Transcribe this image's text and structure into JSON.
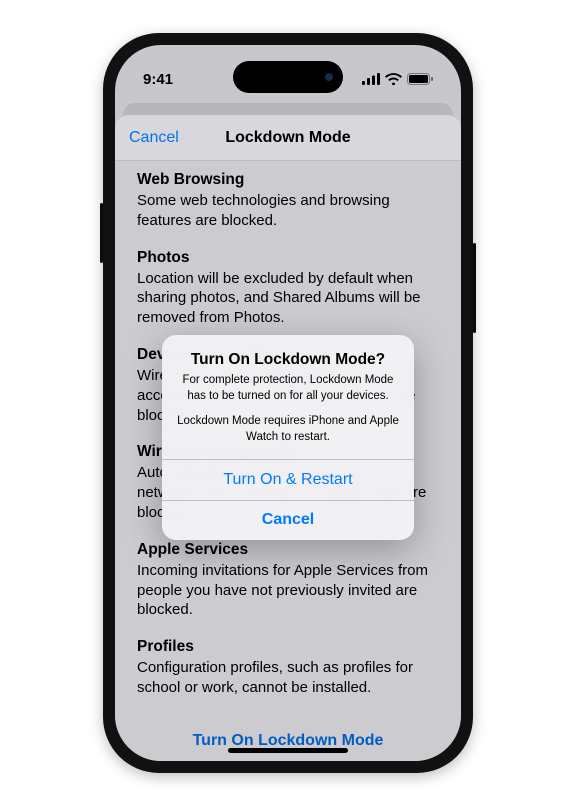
{
  "status": {
    "time": "9:41"
  },
  "nav": {
    "cancel": "Cancel",
    "title": "Lockdown Mode"
  },
  "sections": [
    {
      "title": "Web Browsing",
      "body": "Some web technologies and browsing features are blocked."
    },
    {
      "title": "Photos",
      "body": "Location will be excluded by default when sharing photos, and Shared Albums will be removed from Photos."
    },
    {
      "title": "Device Connections",
      "body": "Wired connections with another device or accessory while your iPhone is locked are blocked."
    },
    {
      "title": "Wireless Connectivity",
      "body": "Automatically joining non-secure Wi-Fi networks and incoming 2G cellular calls are blocked."
    },
    {
      "title": "Apple Services",
      "body": "Incoming invitations for Apple Services from people you have not previously invited are blocked."
    },
    {
      "title": "Profiles",
      "body": "Configuration profiles, such as profiles for school or work, cannot be installed."
    }
  ],
  "primary_button": "Turn On Lockdown Mode",
  "alert": {
    "title": "Turn On Lockdown Mode?",
    "line1": "For complete protection, Lockdown Mode has to be turned on for all your devices.",
    "line2": "Lockdown Mode requires iPhone and Apple Watch to restart.",
    "confirm": "Turn On & Restart",
    "cancel": "Cancel"
  }
}
